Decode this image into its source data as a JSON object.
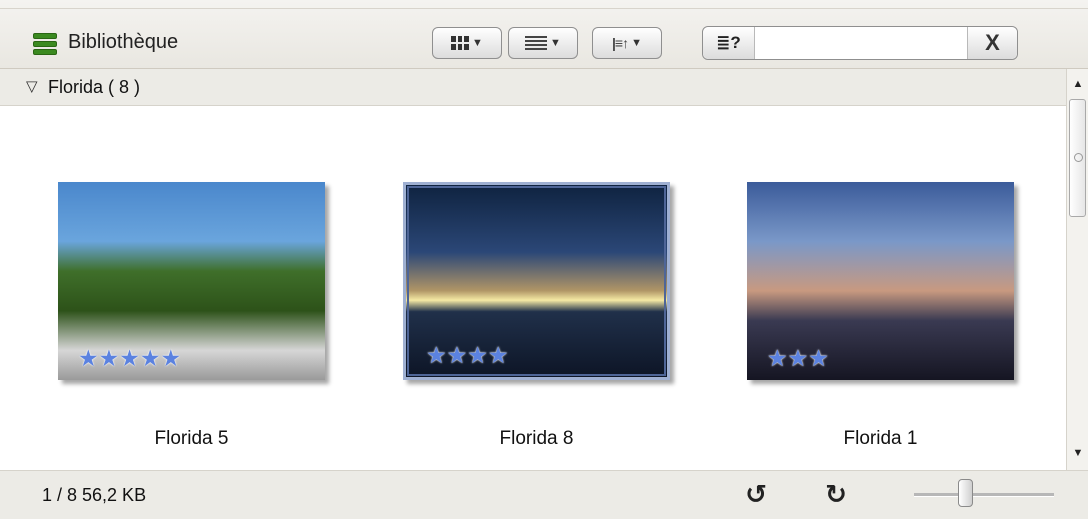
{
  "header": {
    "title": "Bibliothèque",
    "search": {
      "type_icon": "≣?",
      "clear_label": "X",
      "value": ""
    }
  },
  "group": {
    "toggle_glyph": "▽",
    "title": "Florida ( 8 )"
  },
  "photos": [
    {
      "caption": "Florida 5",
      "rating": 5,
      "stars": "★★★★★",
      "selected": false
    },
    {
      "caption": "Florida 8",
      "rating": 4,
      "stars": "★★★★",
      "selected": true
    },
    {
      "caption": "Florida 1",
      "rating": 3,
      "stars": "★★★",
      "selected": false
    }
  ],
  "scrollbar": {
    "up": "▲",
    "down": "▼"
  },
  "status": {
    "text": "1 / 8  56,2 KB",
    "rotate_left": "↺",
    "rotate_right": "↻",
    "zoom_level": 0.35
  },
  "colors": {
    "accent_star": "#5b82e0",
    "selection_border": "#4e6597",
    "library_icon": "#3b8a20"
  }
}
